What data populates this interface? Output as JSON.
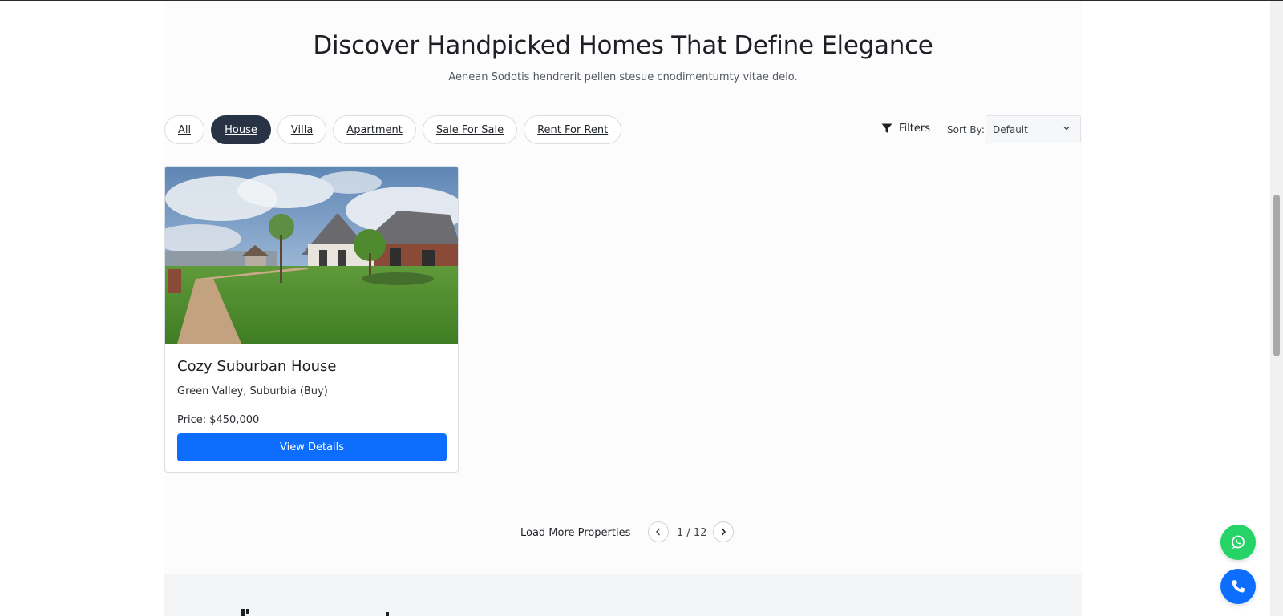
{
  "header": {
    "title": "Discover Handpicked Homes That Define Elegance",
    "subtitle": "Aenean Sodotis hendrerit pellen stesue cnodimentumty vitae delo."
  },
  "tabs": [
    {
      "label": "All",
      "active": false
    },
    {
      "label": "House",
      "active": true
    },
    {
      "label": "Villa",
      "active": false
    },
    {
      "label": "Apartment",
      "active": false
    },
    {
      "label": "Sale For Sale",
      "active": false
    },
    {
      "label": "Rent For Rent",
      "active": false
    }
  ],
  "toolbar": {
    "filters_label": "Filters",
    "sort_label": "Sort By:",
    "sort_value": "Default"
  },
  "listing": {
    "title": "Cozy Suburban House",
    "location": "Green Valley, Suburbia (Buy)",
    "price": "Price: $450,000",
    "button": "View Details"
  },
  "pagination": {
    "load_more": "Load More Properties",
    "page_indicator": "1 / 12"
  },
  "colors": {
    "accent": "#0d6efd",
    "active_tab": "#283445",
    "whatsapp": "#25d366"
  },
  "icons": {
    "filters": "filter-funnel-icon",
    "sort": "chevron-down-icon",
    "prev": "chevron-left-icon",
    "next": "chevron-right-icon",
    "whatsapp": "whatsapp-icon",
    "call": "phone-icon"
  }
}
